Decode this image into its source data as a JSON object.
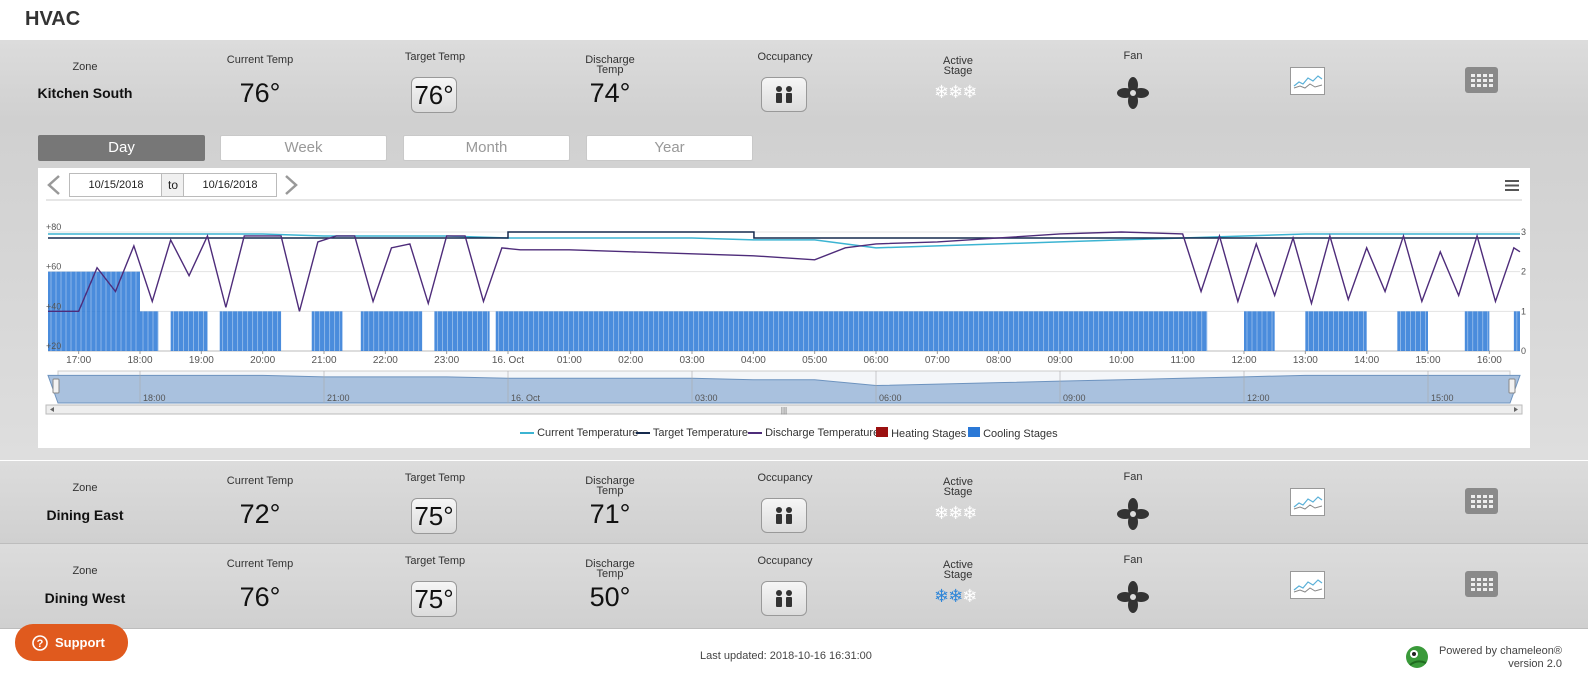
{
  "app": {
    "title": "HVAC"
  },
  "labels": {
    "zone": "Zone",
    "current_temp": "Current Temp",
    "target_temp": "Target Temp",
    "discharge_temp_l1": "Discharge",
    "discharge_temp_l2": "Temp",
    "occupancy": "Occupancy",
    "active_stage_l1": "Active",
    "active_stage_l2": "Stage",
    "fan": "Fan"
  },
  "zones": [
    {
      "name": "Kitchen South",
      "current_temp": "76°",
      "target_temp": "76°",
      "discharge_temp": "74°",
      "active_stages": 0
    },
    {
      "name": "Dining East",
      "current_temp": "72°",
      "target_temp": "75°",
      "discharge_temp": "71°",
      "active_stages": 0
    },
    {
      "name": "Dining West",
      "current_temp": "76°",
      "target_temp": "75°",
      "discharge_temp": "50°",
      "active_stages": 2
    }
  ],
  "tabs": [
    "Day",
    "Week",
    "Month",
    "Year"
  ],
  "active_tab": "Day",
  "date_range": {
    "from": "10/15/2018",
    "to_label": "to",
    "to": "10/16/2018"
  },
  "colors": {
    "current": "#3cb4d2",
    "target": "#152a4e",
    "discharge": "#4e2c7a",
    "heating": "#9b1010",
    "cooling": "#2a78d6",
    "snow_active": "#2f86d8",
    "snow_inactive": "#ffffff"
  },
  "chart_data": {
    "type": "line",
    "x_ticks": [
      "17:00",
      "18:00",
      "19:00",
      "20:00",
      "21:00",
      "22:00",
      "23:00",
      "16. Oct",
      "01:00",
      "02:00",
      "03:00",
      "04:00",
      "05:00",
      "06:00",
      "07:00",
      "08:00",
      "09:00",
      "10:00",
      "11:00",
      "12:00",
      "13:00",
      "14:00",
      "15:00",
      "16:00"
    ],
    "y_left_ticks": [
      "+80",
      "+60",
      "+40",
      "+20"
    ],
    "y_right_ticks": [
      "3",
      "2",
      "1",
      "0"
    ],
    "ylim_left": [
      20,
      80
    ],
    "ylim_right": [
      0,
      3
    ],
    "series": [
      {
        "name": "Current Temperature",
        "x": [
          -0.5,
          1,
          2,
          3,
          4,
          5,
          6,
          7,
          8,
          9,
          10,
          11,
          12,
          13,
          14,
          15,
          16,
          17,
          18,
          19,
          20,
          21,
          22,
          23.5
        ],
        "values": [
          79,
          79,
          79,
          79,
          78,
          78,
          78,
          77,
          77,
          77,
          77,
          76,
          76,
          72,
          73,
          74,
          75,
          76,
          77,
          78,
          79,
          79,
          79,
          79
        ]
      },
      {
        "name": "Target Temperature",
        "x": [
          -0.5,
          6.99,
          7,
          11,
          11.01,
          23.5
        ],
        "values": [
          77,
          77,
          80,
          80,
          77,
          77
        ]
      },
      {
        "name": "Discharge Temperature",
        "x": [
          -0.5,
          0,
          0.3,
          0.6,
          0.9,
          1.2,
          1.5,
          1.8,
          2.1,
          2.4,
          2.7,
          3,
          3.3,
          3.6,
          3.9,
          4.2,
          4.5,
          4.8,
          5.1,
          5.4,
          5.7,
          6,
          6.3,
          6.6,
          6.9,
          7.2,
          8,
          9,
          10,
          11,
          12,
          12.5,
          13,
          14,
          15,
          16,
          17,
          18,
          18.3,
          18.6,
          18.9,
          19.2,
          19.5,
          19.8,
          20.1,
          20.4,
          20.7,
          21,
          21.3,
          21.6,
          21.9,
          22.2,
          22.5,
          22.8,
          23.1,
          23.4,
          23.5
        ],
        "values": [
          40,
          40,
          62,
          50,
          73,
          45,
          76,
          58,
          78,
          42,
          78,
          78,
          78,
          40,
          75,
          78,
          78,
          45,
          72,
          74,
          44,
          78,
          78,
          45,
          72,
          71,
          71,
          70,
          69,
          68,
          66,
          72,
          74,
          75,
          77,
          79,
          80,
          79,
          50,
          78,
          45,
          74,
          48,
          77,
          44,
          78,
          46,
          72,
          50,
          78,
          45,
          70,
          48,
          78,
          45,
          72,
          70
        ]
      },
      {
        "name": "Cooling Stages",
        "axis": "right",
        "x": [
          -0.5,
          1,
          1.3,
          1.5,
          2.1,
          2.3,
          3.3,
          3.8,
          4.3,
          4.6,
          5.6,
          5.8,
          6.7,
          6.8,
          18.1,
          18.4,
          19,
          19.5,
          20,
          21,
          21.5,
          22,
          22.6,
          23,
          23.4
        ],
        "values": [
          2,
          1,
          0,
          1,
          0,
          1,
          0,
          1,
          0,
          1,
          0,
          1,
          0,
          1,
          1,
          0,
          1,
          0,
          1,
          0,
          1,
          0,
          1,
          0,
          1
        ]
      },
      {
        "name": "Heating Stages",
        "values": []
      }
    ],
    "navigator_ticks": [
      "18:00",
      "21:00",
      "16. Oct",
      "03:00",
      "06:00",
      "09:00",
      "12:00",
      "15:00"
    ],
    "legend": [
      "Current Temperature",
      "Target Temperature",
      "Discharge Temperature",
      "Heating Stages",
      "Cooling Stages"
    ],
    "legend_position": "bottom",
    "grid": true
  },
  "footer": {
    "last_updated": "Last updated: 2018-10-16 16:31:00",
    "powered_l1": "Powered by chameleon®",
    "powered_l2": "version 2.0",
    "support_label": "Support"
  }
}
